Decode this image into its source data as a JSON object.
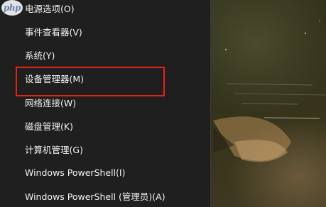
{
  "watermark": {
    "text": "php"
  },
  "menu": {
    "items": [
      {
        "label": "电源选项(O)"
      },
      {
        "label": "事件查看器(V)"
      },
      {
        "label": "系统(Y)"
      },
      {
        "label": "设备管理器(M)"
      },
      {
        "label": "网络连接(W)"
      },
      {
        "label": "磁盘管理(K)"
      },
      {
        "label": "计算机管理(G)"
      },
      {
        "label": "Windows PowerShell(I)"
      },
      {
        "label": "Windows PowerShell (管理员)(A)"
      }
    ],
    "highlighted_item": "设备管理器(M)",
    "highlight_color": "#e2231a",
    "background_color": "#1f1f1f",
    "text_color": "#f2f2f2"
  }
}
